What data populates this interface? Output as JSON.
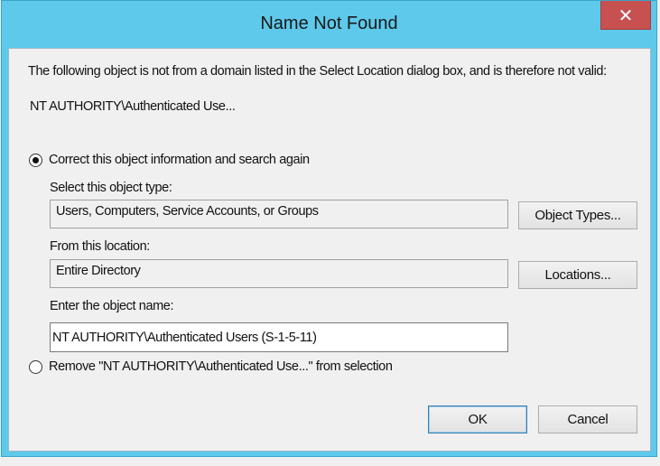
{
  "dialog": {
    "title": "Name Not Found",
    "close_glyph": "✕",
    "message": "The following object is not from a domain listed in the Select Location dialog box, and is therefore not valid:",
    "object_name": "NT AUTHORITY\\Authenticated Use...",
    "option_correct": {
      "label": "Correct this object information and search again",
      "selected": true
    },
    "object_type_label": "Select this object type:",
    "object_type_value": "Users, Computers, Service Accounts, or Groups",
    "object_types_button": "Object Types...",
    "location_label": "From this location:",
    "location_value": "Entire Directory",
    "locations_button": "Locations...",
    "object_name_label": "Enter the object name:",
    "object_name_value": "NT AUTHORITY\\Authenticated Users (S-1-5-11)",
    "option_remove": {
      "label": "Remove \"NT AUTHORITY\\Authenticated Use...\" from selection",
      "selected": false
    },
    "ok_button": "OK",
    "cancel_button": "Cancel"
  },
  "colors": {
    "titlebar": "#5ec9ea",
    "close_button": "#c75050",
    "client_background": "#f0f0f0",
    "focus_border": "#3c7fb1"
  },
  "icons": {
    "close": "close-icon",
    "radio": "radio-button"
  }
}
